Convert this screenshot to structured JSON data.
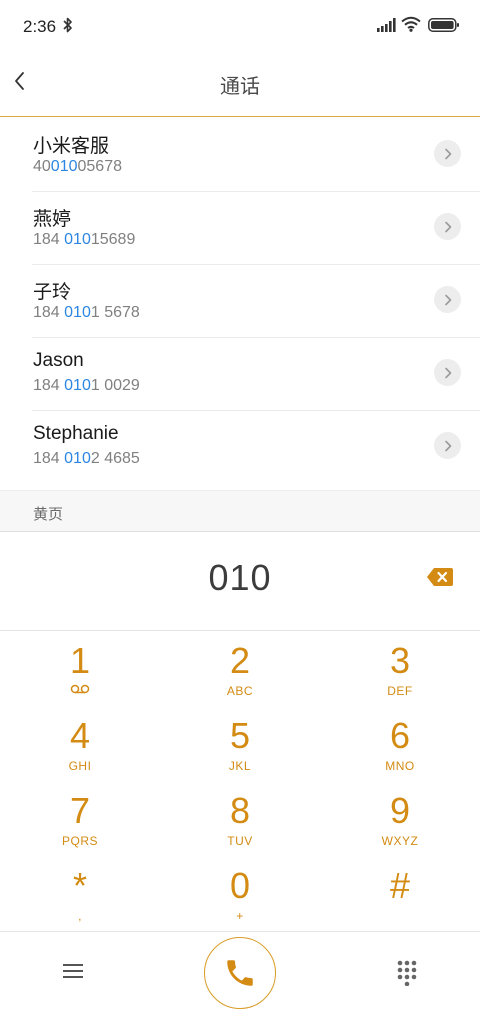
{
  "status_bar": {
    "time": "2:36",
    "icons": [
      "bluetooth-icon",
      "signal-icon",
      "wifi-icon",
      "battery-icon"
    ]
  },
  "header": {
    "title": "通话",
    "back_icon": "chevron-left-icon"
  },
  "contacts": [
    {
      "name": "小米客服",
      "number_pre": "40",
      "number_match": "010",
      "number_post": "05678"
    },
    {
      "name": "燕婷",
      "number_pre": "184 ",
      "number_match": "010",
      "number_post": "15689"
    },
    {
      "name": "子玲",
      "number_pre": "184 ",
      "number_match": "010",
      "number_post": "1 5678"
    },
    {
      "name": "Jason",
      "number_pre": "184 ",
      "number_match": "010",
      "number_post": "1 0029"
    },
    {
      "name": "Stephanie",
      "number_pre": "184 ",
      "number_match": "010",
      "number_post": "2 4685"
    }
  ],
  "yellow_pages": {
    "label": "黄页"
  },
  "dialer": {
    "input": "010",
    "keys": [
      {
        "digit": "1",
        "letters": ""
      },
      {
        "digit": "2",
        "letters": "ABC"
      },
      {
        "digit": "3",
        "letters": "DEF"
      },
      {
        "digit": "4",
        "letters": "GHI"
      },
      {
        "digit": "5",
        "letters": "JKL"
      },
      {
        "digit": "6",
        "letters": "MNO"
      },
      {
        "digit": "7",
        "letters": "PQRS"
      },
      {
        "digit": "8",
        "letters": "TUV"
      },
      {
        "digit": "9",
        "letters": "WXYZ"
      },
      {
        "digit": "*",
        "letters": ","
      },
      {
        "digit": "0",
        "letters": "+"
      },
      {
        "digit": "#",
        "letters": ""
      }
    ]
  },
  "colors": {
    "accent": "#d38b13",
    "highlight": "#2d86e2",
    "divider_accent": "#d9a844"
  }
}
